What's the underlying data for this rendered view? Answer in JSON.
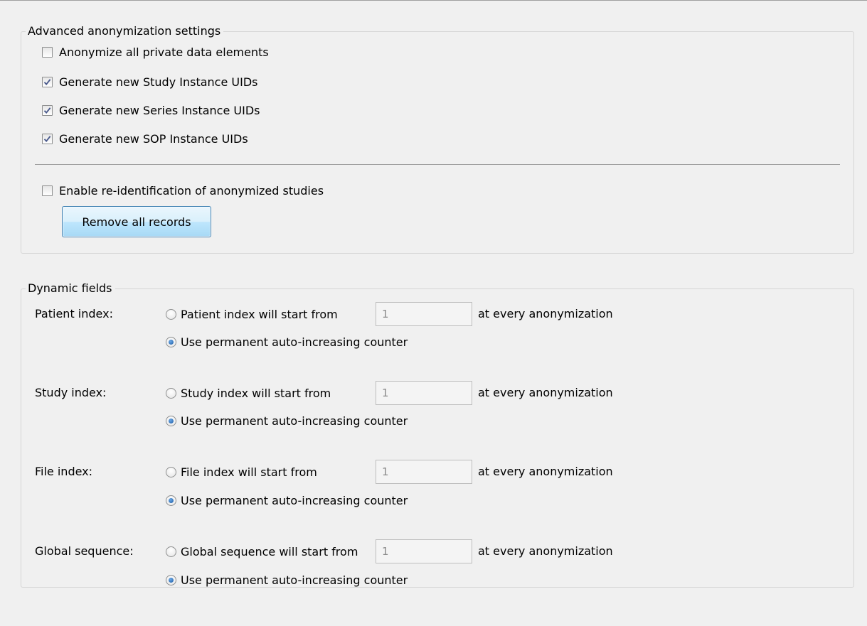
{
  "advanced": {
    "legend": "Advanced anonymization settings",
    "options": [
      {
        "label": "Anonymize all private data elements",
        "checked": false
      },
      {
        "label": "Generate new Study Instance UIDs",
        "checked": true
      },
      {
        "label": "Generate new Series Instance UIDs",
        "checked": true
      },
      {
        "label": "Generate new SOP Instance UIDs",
        "checked": true
      }
    ],
    "reidentify": {
      "label": "Enable re-identification of anonymized studies",
      "checked": false
    },
    "remove_button": "Remove all records"
  },
  "dynamic": {
    "legend": "Dynamic fields",
    "fields": [
      {
        "label": "Patient index:",
        "start_label": "Patient index will start from",
        "start_value": "1",
        "suffix": "at every anonymization",
        "counter_label": "Use permanent auto-increasing counter",
        "selected": "counter"
      },
      {
        "label": "Study index:",
        "start_label": "Study index will start from",
        "start_value": "1",
        "suffix": "at every anonymization",
        "counter_label": "Use permanent auto-increasing counter",
        "selected": "counter"
      },
      {
        "label": "File index:",
        "start_label": "File index will start from",
        "start_value": "1",
        "suffix": "at every anonymization",
        "counter_label": "Use permanent auto-increasing counter",
        "selected": "counter"
      },
      {
        "label": "Global sequence:",
        "start_label": "Global sequence will start from",
        "start_value": "1",
        "suffix": "at every anonymization",
        "counter_label": "Use permanent auto-increasing counter",
        "selected": "counter"
      }
    ]
  }
}
